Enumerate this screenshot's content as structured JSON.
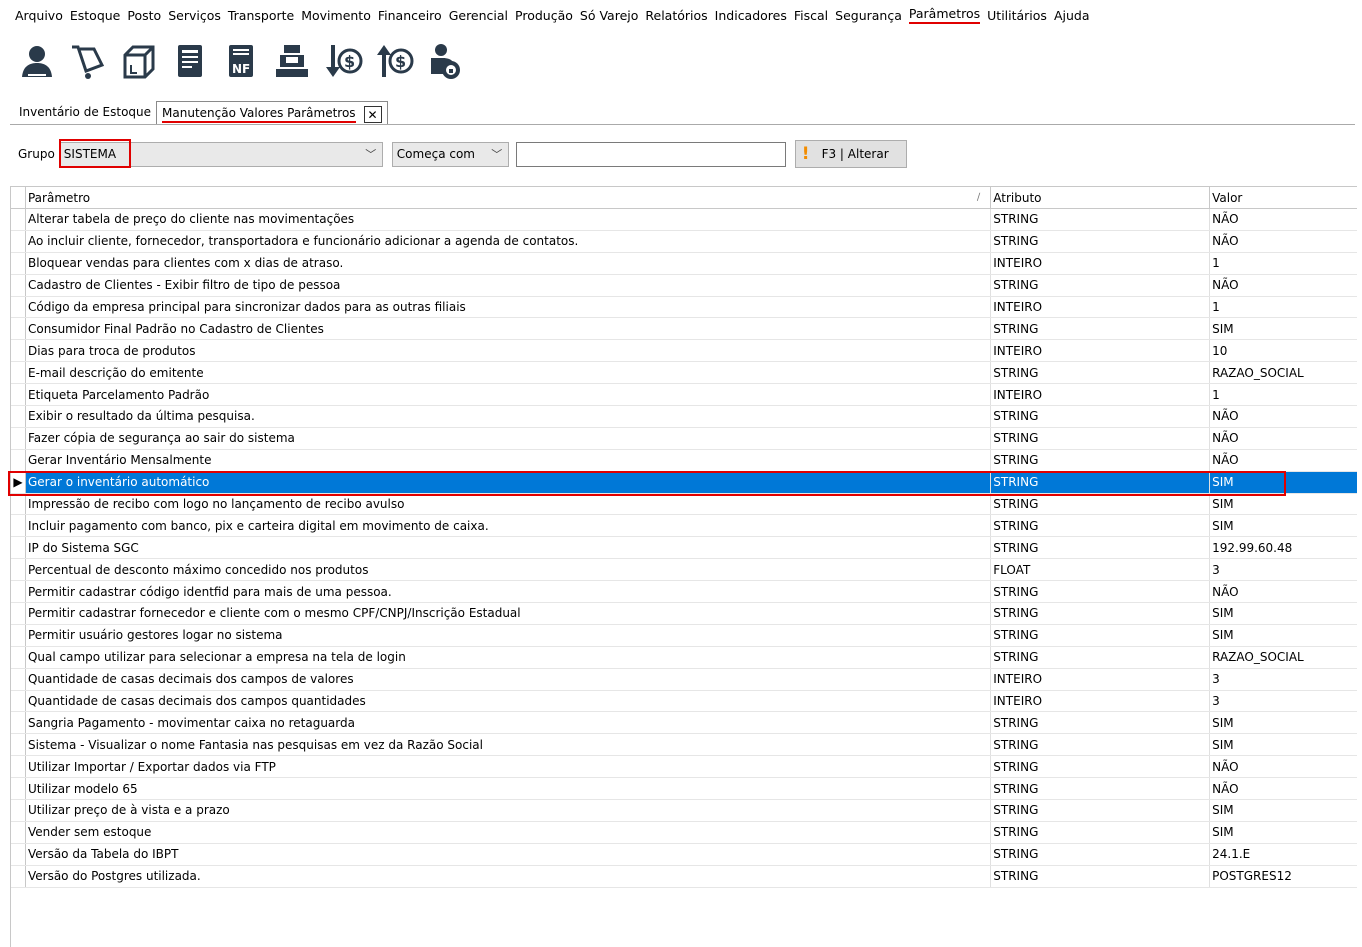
{
  "menu": [
    "Arquivo",
    "Estoque",
    "Posto",
    "Serviços",
    "Transporte",
    "Movimento",
    "Financeiro",
    "Gerencial",
    "Produção",
    "Só Varejo",
    "Relatórios",
    "Indicadores",
    "Fiscal",
    "Segurança",
    "Parâmetros",
    "Utilitários",
    "Ajuda"
  ],
  "active_menu": "Parâmetros",
  "toolbar_icons": [
    "person-icon",
    "shopping-cart-icon",
    "box-icon",
    "document-icon",
    "nf-invoice-icon",
    "cash-register-icon",
    "money-down-icon",
    "money-up-icon",
    "person-lock-icon"
  ],
  "tabs": {
    "inventario": "Inventário de Estoque",
    "manutencao": "Manutenção Valores Parâmetros",
    "close": "✕"
  },
  "filter": {
    "grupo_label": "Grupo",
    "grupo_value": "SISTEMA",
    "comeca_value": "Começa com",
    "search_value": "",
    "alterar_label": "F3 | Alterar"
  },
  "grid": {
    "headers": {
      "parametro": "Parâmetro",
      "atributo": "Atributo",
      "valor": "Valor"
    },
    "selected_index": 12,
    "rows": [
      {
        "p": "Alterar tabela de preço do cliente nas movimentações",
        "a": "STRING",
        "v": "NÃO"
      },
      {
        "p": "Ao incluir cliente, fornecedor, transportadora e funcionário adicionar a agenda de contatos.",
        "a": "STRING",
        "v": "NÃO"
      },
      {
        "p": "Bloquear vendas para clientes com x dias de atraso.",
        "a": "INTEIRO",
        "v": "1"
      },
      {
        "p": "Cadastro de Clientes - Exibir filtro de tipo de pessoa",
        "a": "STRING",
        "v": "NÃO"
      },
      {
        "p": "Código da empresa principal para sincronizar dados para as outras filiais",
        "a": "INTEIRO",
        "v": "1"
      },
      {
        "p": "Consumidor Final Padrão no Cadastro de Clientes",
        "a": "STRING",
        "v": "SIM"
      },
      {
        "p": "Dias para troca de produtos",
        "a": "INTEIRO",
        "v": "10"
      },
      {
        "p": "E-mail descrição do emitente",
        "a": "STRING",
        "v": "RAZAO_SOCIAL"
      },
      {
        "p": "Etiqueta Parcelamento Padrão",
        "a": "INTEIRO",
        "v": "1"
      },
      {
        "p": "Exibir o resultado da última pesquisa.",
        "a": "STRING",
        "v": "NÃO"
      },
      {
        "p": "Fazer cópia de segurança ao sair do sistema",
        "a": "STRING",
        "v": "NÃO"
      },
      {
        "p": "Gerar Inventário Mensalmente",
        "a": "STRING",
        "v": "NÃO"
      },
      {
        "p": "Gerar o inventário automático",
        "a": "STRING",
        "v": "SIM"
      },
      {
        "p": "Impressão de recibo com logo no lançamento de recibo avulso",
        "a": "STRING",
        "v": "SIM"
      },
      {
        "p": "Incluir pagamento com banco, pix e carteira digital em movimento de caixa.",
        "a": "STRING",
        "v": "SIM"
      },
      {
        "p": "IP do Sistema SGC",
        "a": "STRING",
        "v": "192.99.60.48"
      },
      {
        "p": "Percentual de desconto máximo concedido nos produtos",
        "a": "FLOAT",
        "v": "3"
      },
      {
        "p": "Permitir cadastrar código identfid para mais de uma pessoa.",
        "a": "STRING",
        "v": "NÃO"
      },
      {
        "p": "Permitir cadastrar fornecedor e cliente com o mesmo CPF/CNPJ/Inscrição Estadual",
        "a": "STRING",
        "v": "SIM"
      },
      {
        "p": "Permitir usuário gestores logar no sistema",
        "a": "STRING",
        "v": "SIM"
      },
      {
        "p": "Qual campo utilizar para selecionar a empresa na tela de login",
        "a": "STRING",
        "v": "RAZAO_SOCIAL"
      },
      {
        "p": "Quantidade de casas decimais dos campos de valores",
        "a": "INTEIRO",
        "v": "3"
      },
      {
        "p": "Quantidade de casas decimais dos campos quantidades",
        "a": "INTEIRO",
        "v": "3"
      },
      {
        "p": "Sangria Pagamento - movimentar caixa no retaguarda",
        "a": "STRING",
        "v": "SIM"
      },
      {
        "p": "Sistema - Visualizar o nome Fantasia nas pesquisas em vez da Razão Social",
        "a": "STRING",
        "v": "SIM"
      },
      {
        "p": "Utilizar Importar / Exportar dados via FTP",
        "a": "STRING",
        "v": "NÃO"
      },
      {
        "p": "Utilizar modelo 65",
        "a": "STRING",
        "v": "NÃO"
      },
      {
        "p": "Utilizar preço de à vista e a prazo",
        "a": "STRING",
        "v": "SIM"
      },
      {
        "p": "Vender sem estoque",
        "a": "STRING",
        "v": "SIM"
      },
      {
        "p": "Versão da Tabela do IBPT",
        "a": "STRING",
        "v": "24.1.E"
      },
      {
        "p": "Versão do Postgres utilizada.",
        "a": "STRING",
        "v": "POSTGRES12"
      }
    ]
  },
  "colors": {
    "accent": "#0078d7",
    "highlight": "#e00000"
  }
}
